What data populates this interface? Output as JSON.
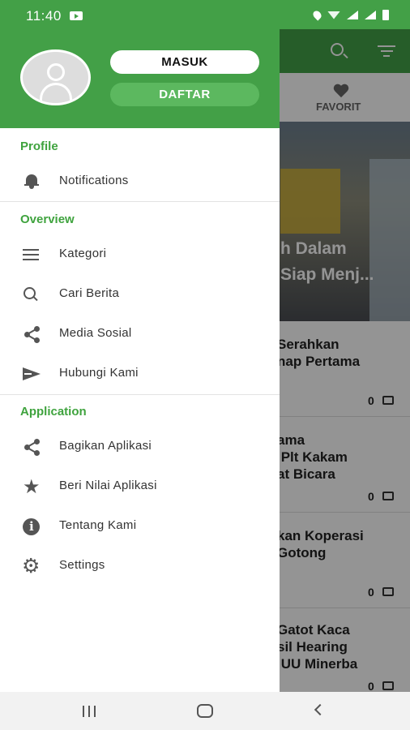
{
  "status_bar": {
    "time": "11:40"
  },
  "background": {
    "tab_favorit": "FAVORIT",
    "hero_title": "h Dalam\nSiap Menj...",
    "items": [
      {
        "title": "Serahkan\nnap Pertama",
        "count": "0"
      },
      {
        "title": "ama\n Plt Kakam\nat Bicara",
        "count": "0"
      },
      {
        "title": "kan Koperasi\nGotong",
        "count": "0"
      },
      {
        "title": "Gatot Kaca\nsil Hearing\n UU Minerba",
        "count": "0"
      }
    ]
  },
  "drawer": {
    "login_label": "MASUK",
    "register_label": "DAFTAR",
    "sections": {
      "profile": "Profile",
      "overview": "Overview",
      "application": "Application"
    },
    "items": {
      "notifications": "Notifications",
      "kategori": "Kategori",
      "cari_berita": "Cari Berita",
      "media_sosial": "Media Sosial",
      "hubungi_kami": "Hubungi Kami",
      "bagikan_aplikasi": "Bagikan Aplikasi",
      "beri_nilai": "Beri Nilai Aplikasi",
      "tentang_kami": "Tentang Kami",
      "settings": "Settings"
    },
    "icons": {
      "notifications": "bell-icon",
      "kategori": "menu-icon",
      "cari_berita": "search-icon",
      "media_sosial": "share-icon",
      "hubungi_kami": "send-icon",
      "bagikan_aplikasi": "share-icon",
      "beri_nilai": "star-icon",
      "tentang_kami": "info-icon",
      "settings": "gear-icon"
    },
    "accent_color": "#43a047"
  }
}
